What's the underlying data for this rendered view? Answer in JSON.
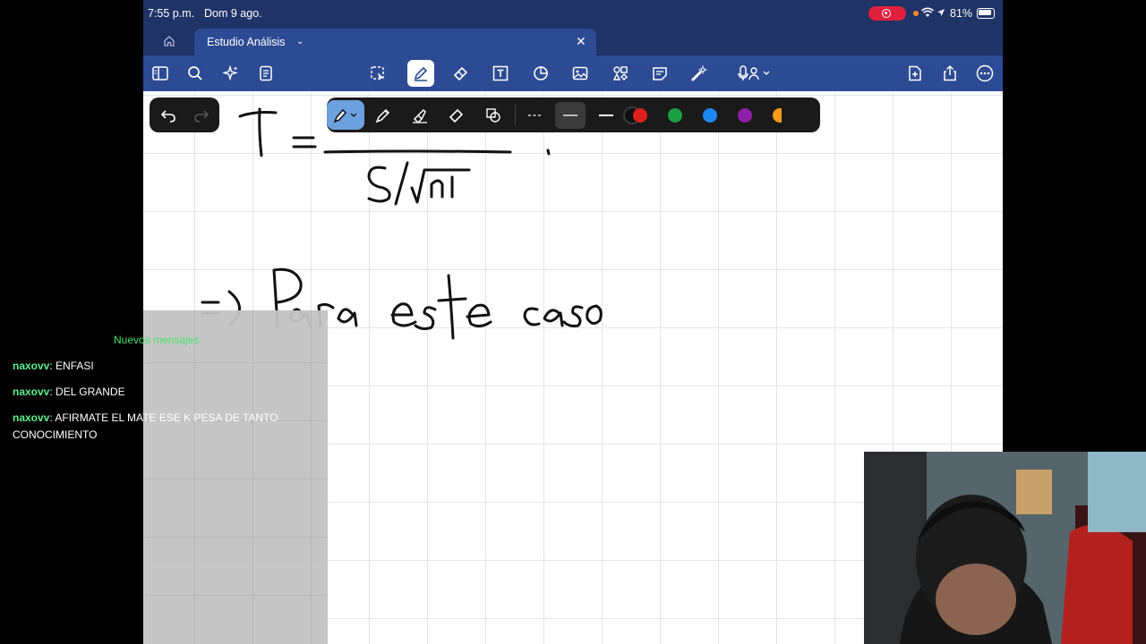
{
  "status_bar": {
    "time": "7:55 p.m.",
    "date": "Dom 9 ago.",
    "battery": "81%"
  },
  "tab": {
    "title": "Estudio Análisis"
  },
  "chat": {
    "header": "Nuevos mensajes",
    "messages": [
      {
        "user": "naxovv",
        "text": ": ENFASI"
      },
      {
        "user": "naxovv",
        "text": ": DEL GRANDE"
      },
      {
        "user": "naxovv",
        "text": ": AFIRMATE EL MATE ESE K PESA DE TANTO CONOCIMIENTO"
      }
    ]
  },
  "pen_colors": [
    "#111111",
    "#e01f1f",
    "#1aa043",
    "#1e88f0",
    "#8e1fa8",
    "#f59a1c"
  ],
  "toolbar_icons": [
    "sidebar-icon",
    "search-icon",
    "sparkle-icon",
    "document-icon",
    "lasso-icon",
    "pen-icon",
    "eraser-icon",
    "text-icon",
    "shapes-icon",
    "image-icon",
    "elements-icon",
    "sticky-note-icon",
    "laser-icon",
    "microphone-icon",
    "add-page-icon",
    "share-icon",
    "more-icon"
  ]
}
